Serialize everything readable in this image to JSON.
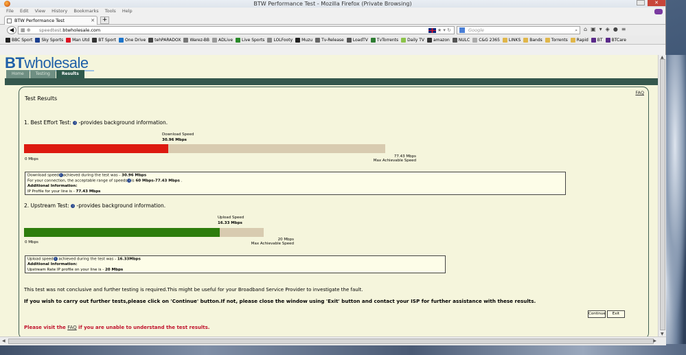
{
  "window": {
    "title": "BTW Performance Test - Mozilla Firefox (Private Browsing)"
  },
  "menu": [
    "File",
    "Edit",
    "View",
    "History",
    "Bookmarks",
    "Tools",
    "Help"
  ],
  "tab": {
    "label": "BTW Performance Test"
  },
  "url": {
    "prefix": "speedtest.",
    "domain": "btwholesale.com"
  },
  "search": {
    "placeholder": "Google"
  },
  "bookmarks": [
    {
      "label": "BBC Sport",
      "color": "#222"
    },
    {
      "label": "Sky Sports",
      "color": "#1b3f8f"
    },
    {
      "label": "Man Utd",
      "color": "#d12"
    },
    {
      "label": "BT Sport",
      "color": "#333"
    },
    {
      "label": "One Drive",
      "color": "#1c74c9"
    },
    {
      "label": "tehPARADOX",
      "color": "#444"
    },
    {
      "label": "Warez-BB",
      "color": "#777"
    },
    {
      "label": "ADLive",
      "color": "#999"
    },
    {
      "label": "Live Sports",
      "color": "#2a8a2a"
    },
    {
      "label": "LOLFooty",
      "color": "#888"
    },
    {
      "label": "Muzu",
      "color": "#222"
    },
    {
      "label": "Tv-Release",
      "color": "#666"
    },
    {
      "label": "LoadTV",
      "color": "#555"
    },
    {
      "label": "TvTorrents",
      "color": "#2e7d32"
    },
    {
      "label": "Daily TV",
      "color": "#8bc34a"
    },
    {
      "label": "amazon",
      "color": "#333"
    },
    {
      "label": "NULC",
      "color": "#555"
    },
    {
      "label": "C&G 2365",
      "color": "#aaa"
    },
    {
      "label": "LINKS",
      "color": "#e0b64a"
    },
    {
      "label": "Bands",
      "color": "#e0b64a"
    },
    {
      "label": "Torrents",
      "color": "#e0b64a"
    },
    {
      "label": "Rapid",
      "color": "#e0b64a"
    },
    {
      "label": "BT",
      "color": "#5a2a8a"
    },
    {
      "label": "BTCare",
      "color": "#5a2a8a"
    }
  ],
  "brand": {
    "bt": "BT",
    "wholesale": "wholesale"
  },
  "nav_tabs": [
    "Home",
    "Testing",
    "Results"
  ],
  "faq": "FAQ",
  "results_title": "Test Results",
  "download": {
    "section": "1. Best Effort Test:",
    "section_suffix": "-provides background information.",
    "bar_title": "Download Speed",
    "speed": "30.96 Mbps",
    "fraction": 0.3999,
    "min": "0 Mbps",
    "max": "77.43 Mbps",
    "max_caption": "Max Achievable Speed",
    "line1_a": "Download speed",
    "line1_b": "achieved during the test was - ",
    "line1_val": "30.96 Mbps",
    "line2_a": "For your connection, the acceptable range of speeds",
    "line2_b": "is ",
    "line2_val": "60 Mbps-77.43 Mbps",
    "line2_end": " .",
    "addl": "Additional Information:",
    "line3_a": "IP Profile for your line is - ",
    "line3_val": "77.43 Mbps"
  },
  "upload": {
    "section": "2. Upstream Test:",
    "section_suffix": "-provides background information.",
    "bar_title": "Upload Speed",
    "speed": "16.33 Mbps",
    "fraction": 0.8165,
    "min": "0 Mbps",
    "max": "20 Mbps",
    "max_caption": "Max Achievable Speed",
    "line1_a": "Upload speed",
    "line1_b": " achieved during the test was - ",
    "line1_val": "16.33Mbps",
    "addl": "Additional Information:",
    "line3_a": "Upstream Rate IP profile on your line is - ",
    "line3_val": "20 Mbps"
  },
  "msg1": "This test was not conclusive and further testing is required.This might be useful for your Broadband Service Provider to investigate the fault.",
  "msg2": "If you wish to carry out further tests,please click on 'Continue' button.If not, please close the window using 'Exit' button and contact your ISP for further assistance with these results.",
  "buttons": {
    "continue": "Continue",
    "exit": "Exit"
  },
  "visit": {
    "a": "Please visit the ",
    "link": "FAQ",
    "b": " if you are unable to understand the test results."
  },
  "colors": {
    "download_bar": "#dd1a10",
    "upload_bar": "#2d7d0c",
    "track": "#d8cbb0",
    "header": "#35574d"
  }
}
